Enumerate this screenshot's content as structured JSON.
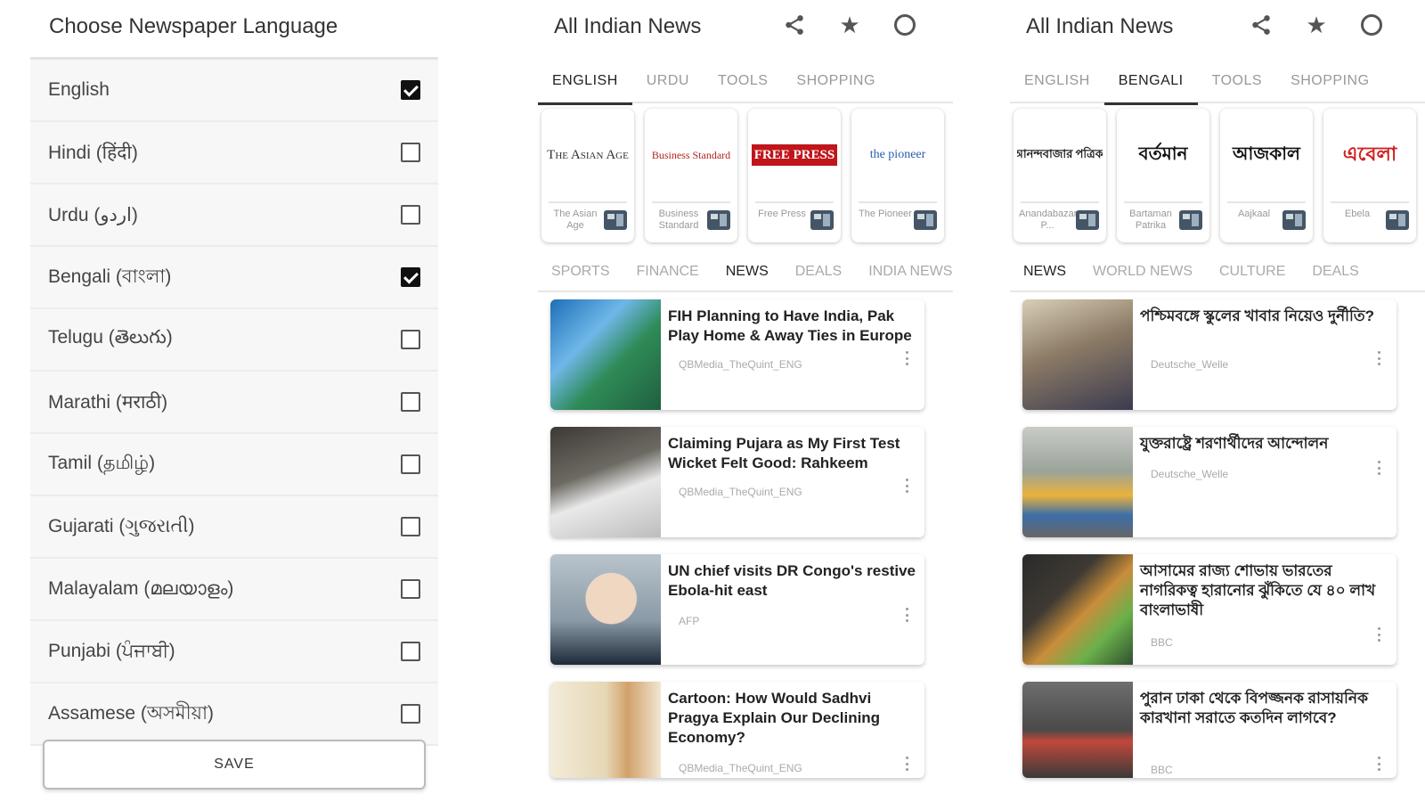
{
  "language_screen": {
    "title": "Choose Newspaper Language",
    "languages": [
      {
        "label": "English",
        "checked": true
      },
      {
        "label": "Hindi (हिंदी)",
        "checked": false
      },
      {
        "label": "Urdu (اردو)",
        "checked": false
      },
      {
        "label": "Bengali (বাংলা)",
        "checked": true
      },
      {
        "label": "Telugu (తెలుగు)",
        "checked": false
      },
      {
        "label": "Marathi (मराठी)",
        "checked": false
      },
      {
        "label": "Tamil (தமிழ்)",
        "checked": false
      },
      {
        "label": "Gujarati (ગુજરાતી)",
        "checked": false
      },
      {
        "label": "Malayalam (മലയാളം)",
        "checked": false
      },
      {
        "label": "Punjabi (ਪੰਜਾਬੀ)",
        "checked": false
      },
      {
        "label": "Assamese (অসমীয়া)",
        "checked": false
      }
    ],
    "save_label": "SAVE"
  },
  "english_screen": {
    "app_title": "All Indian News",
    "icons": [
      "share-icon",
      "star-icon",
      "circle-icon"
    ],
    "tabs": [
      {
        "label": "ENGLISH",
        "active": true
      },
      {
        "label": "URDU",
        "active": false
      },
      {
        "label": "TOOLS",
        "active": false
      },
      {
        "label": "SHOPPING",
        "active": false
      }
    ],
    "papers": [
      {
        "logo": "The Asian Age",
        "name": "The Asian Age",
        "logo_color": "#333333"
      },
      {
        "logo": "Business Standard",
        "name": "Business Standard",
        "logo_color": "#b22222"
      },
      {
        "logo": "FREE PRESS",
        "name": "Free Press",
        "logo_color": "#ffffff"
      },
      {
        "logo": "the pioneer",
        "name": "The Pioneer",
        "logo_color": "#2a5db0"
      }
    ],
    "subtabs": [
      {
        "label": "SPORTS",
        "active": false
      },
      {
        "label": "FINANCE",
        "active": false
      },
      {
        "label": "NEWS",
        "active": true
      },
      {
        "label": "DEALS",
        "active": false
      },
      {
        "label": "INDIA NEWS",
        "active": false
      }
    ],
    "articles": [
      {
        "title": "FIH Planning to Have India, Pak Play Home & Away Ties in Europe",
        "source": "QBMedia_TheQuint_ENG",
        "thumb": "hockey"
      },
      {
        "title": "Claiming Pujara as My First Test Wicket Felt Good: Rahkeem",
        "source": "QBMedia_TheQuint_ENG",
        "thumb": "cricket"
      },
      {
        "title": "UN chief visits DR Congo's restive Ebola-hit east",
        "source": "AFP",
        "thumb": "un"
      },
      {
        "title": "Cartoon: How Would Sadhvi Pragya Explain Our Declining Economy?",
        "source": "QBMedia_TheQuint_ENG",
        "thumb": "cartoon"
      }
    ]
  },
  "bengali_screen": {
    "app_title": "All Indian News",
    "icons": [
      "share-icon",
      "star-icon",
      "circle-icon"
    ],
    "tabs": [
      {
        "label": "ENGLISH",
        "active": false
      },
      {
        "label": "BENGALI",
        "active": true
      },
      {
        "label": "TOOLS",
        "active": false
      },
      {
        "label": "SHOPPING",
        "active": false
      }
    ],
    "papers": [
      {
        "logo": "আনন্দবাজার পত্রিকা",
        "name": "Anandabazar P...",
        "logo_color": "#222222"
      },
      {
        "logo": "বর্তমান",
        "name": "Bartaman Patrika",
        "logo_color": "#111111"
      },
      {
        "logo": "আজকাল",
        "name": "Aajkaal",
        "logo_color": "#111111"
      },
      {
        "logo": "এবেলা",
        "name": "Ebela",
        "logo_color": "#d11f1f"
      }
    ],
    "subtabs": [
      {
        "label": "NEWS",
        "active": true
      },
      {
        "label": "WORLD NEWS",
        "active": false
      },
      {
        "label": "CULTURE",
        "active": false
      },
      {
        "label": "DEALS",
        "active": false
      }
    ],
    "articles": [
      {
        "title": "পশ্চিমবঙ্গে স্কুলের খাবার নিয়েও দুর্নীতি?",
        "source": "Deutsche_Welle",
        "thumb": "kids"
      },
      {
        "title": "যুক্তরাষ্ট্রে শরণার্থীদের আন্দোলন",
        "source": "Deutsche_Welle",
        "thumb": "crowd"
      },
      {
        "title": "আসামের রাজ্য শোভায় ভারতের নাগরিকত্ব হারানোর ঝুঁকিতে যে ৪০ লাখ বাংলাভাষী",
        "source": "BBC",
        "thumb": "mother"
      },
      {
        "title": "পুরান ঢাকা থেকে বিপজ্জনক রাসায়নিক কারখানা সরাতে কতদিন লাগবে?",
        "source": "BBC",
        "thumb": "ruins"
      }
    ]
  }
}
